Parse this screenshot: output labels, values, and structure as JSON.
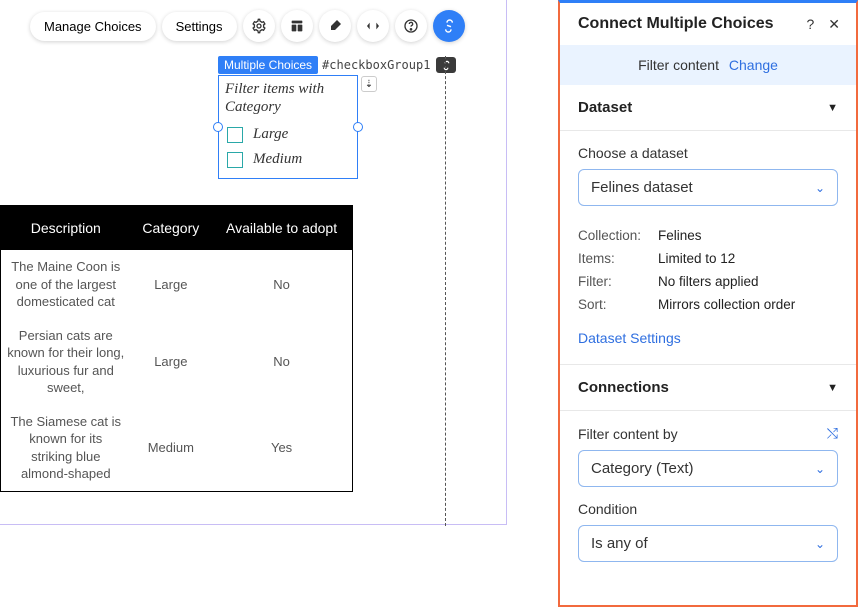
{
  "toolbar": {
    "manage_label": "Manage Choices",
    "settings_label": "Settings"
  },
  "widget": {
    "tag": "Multiple Choices",
    "id": "#checkboxGroup1",
    "title": "Filter items with Category",
    "options": [
      "Large",
      "Medium"
    ]
  },
  "table": {
    "headers": [
      "Description",
      "Category",
      "Available to adopt"
    ],
    "rows": [
      {
        "desc": "The Maine Coon is one of the largest domesticated cat",
        "category": "Large",
        "avail": "No"
      },
      {
        "desc": "Persian cats are known for their long, luxurious fur and sweet,",
        "category": "Large",
        "avail": "No"
      },
      {
        "desc": "The Siamese cat is known for its striking blue almond-shaped",
        "category": "Medium",
        "avail": "Yes"
      }
    ]
  },
  "panel": {
    "title": "Connect Multiple Choices",
    "banner_text": "Filter content",
    "banner_link": "Change",
    "dataset_section": "Dataset",
    "choose_dataset_label": "Choose a dataset",
    "dataset_selected": "Felines dataset",
    "info": {
      "collection_k": "Collection:",
      "collection_v": "Felines",
      "items_k": "Items:",
      "items_v": "Limited to 12",
      "filter_k": "Filter:",
      "filter_v": "No filters applied",
      "sort_k": "Sort:",
      "sort_v": "Mirrors collection order"
    },
    "dataset_settings_link": "Dataset Settings",
    "connections_section": "Connections",
    "filter_by_label": "Filter content by",
    "filter_by_selected": "Category (Text)",
    "condition_label": "Condition",
    "condition_selected": "Is any of"
  }
}
